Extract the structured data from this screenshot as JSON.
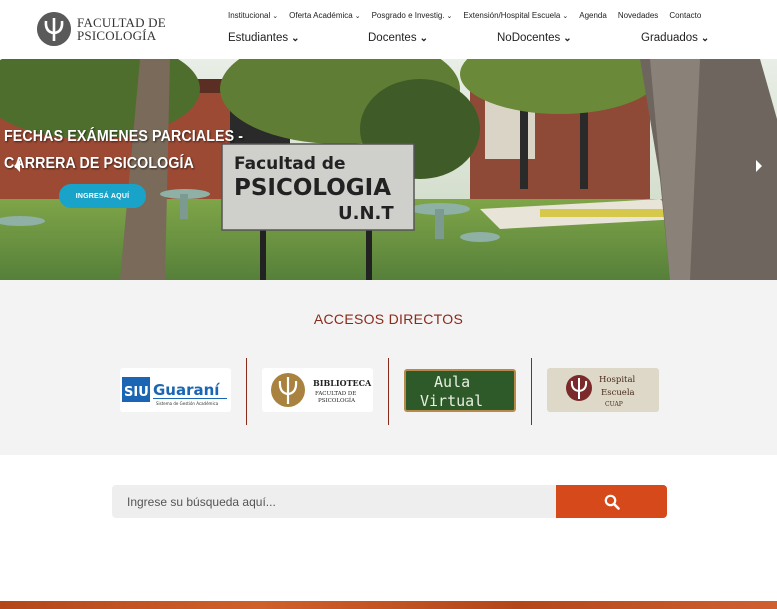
{
  "header": {
    "logo_line1": "FACULTAD DE",
    "logo_line2": "PSICOLOGÍA",
    "top_nav": [
      {
        "label": "Institucional",
        "dropdown": true
      },
      {
        "label": "Oferta Académica",
        "dropdown": true
      },
      {
        "label": "Posgrado e Investig.",
        "dropdown": true
      },
      {
        "label": "Extensión/Hospital Escuela",
        "dropdown": true
      },
      {
        "label": "Agenda",
        "dropdown": false
      },
      {
        "label": "Novedades",
        "dropdown": false
      },
      {
        "label": "Contacto",
        "dropdown": false
      }
    ],
    "main_nav": [
      {
        "label": "Estudiantes"
      },
      {
        "label": "Docentes"
      },
      {
        "label": "NoDocentes"
      },
      {
        "label": "Graduados"
      }
    ]
  },
  "hero": {
    "title_line1": "FECHAS EXÁMENES PARCIALES -",
    "title_line2": "CARRERA DE PSICOLOGÍA",
    "button_label": "INGRESÁ  AQUÍ",
    "sign_line1": "Facultad de",
    "sign_line2": "PSICOLOGIA",
    "sign_line3": "U.N.T",
    "prev_icon": "chevron-left-icon",
    "next_icon": "chevron-right-icon"
  },
  "accesos": {
    "title": "ACCESOS DIRECTOS",
    "siu": {
      "brand1": "SIU",
      "brand2": "Guaraní",
      "tagline": "Sistema de Gestión Académica"
    },
    "biblioteca": {
      "line1": "BIBLIOTECA",
      "line2": "FACULTAD DE",
      "line3": "PSICOLOGÍA"
    },
    "aula": {
      "line1": "Aula",
      "line2": "Virtual"
    },
    "hospital": {
      "line1": "Hospital",
      "line2": "Escuela",
      "line3": "CUAP"
    },
    "divider_color": "#8a2a1a"
  },
  "search": {
    "placeholder": "Ingrese su búsqueda aquí...",
    "button_icon": "search-icon",
    "button_color": "#d5491b"
  }
}
